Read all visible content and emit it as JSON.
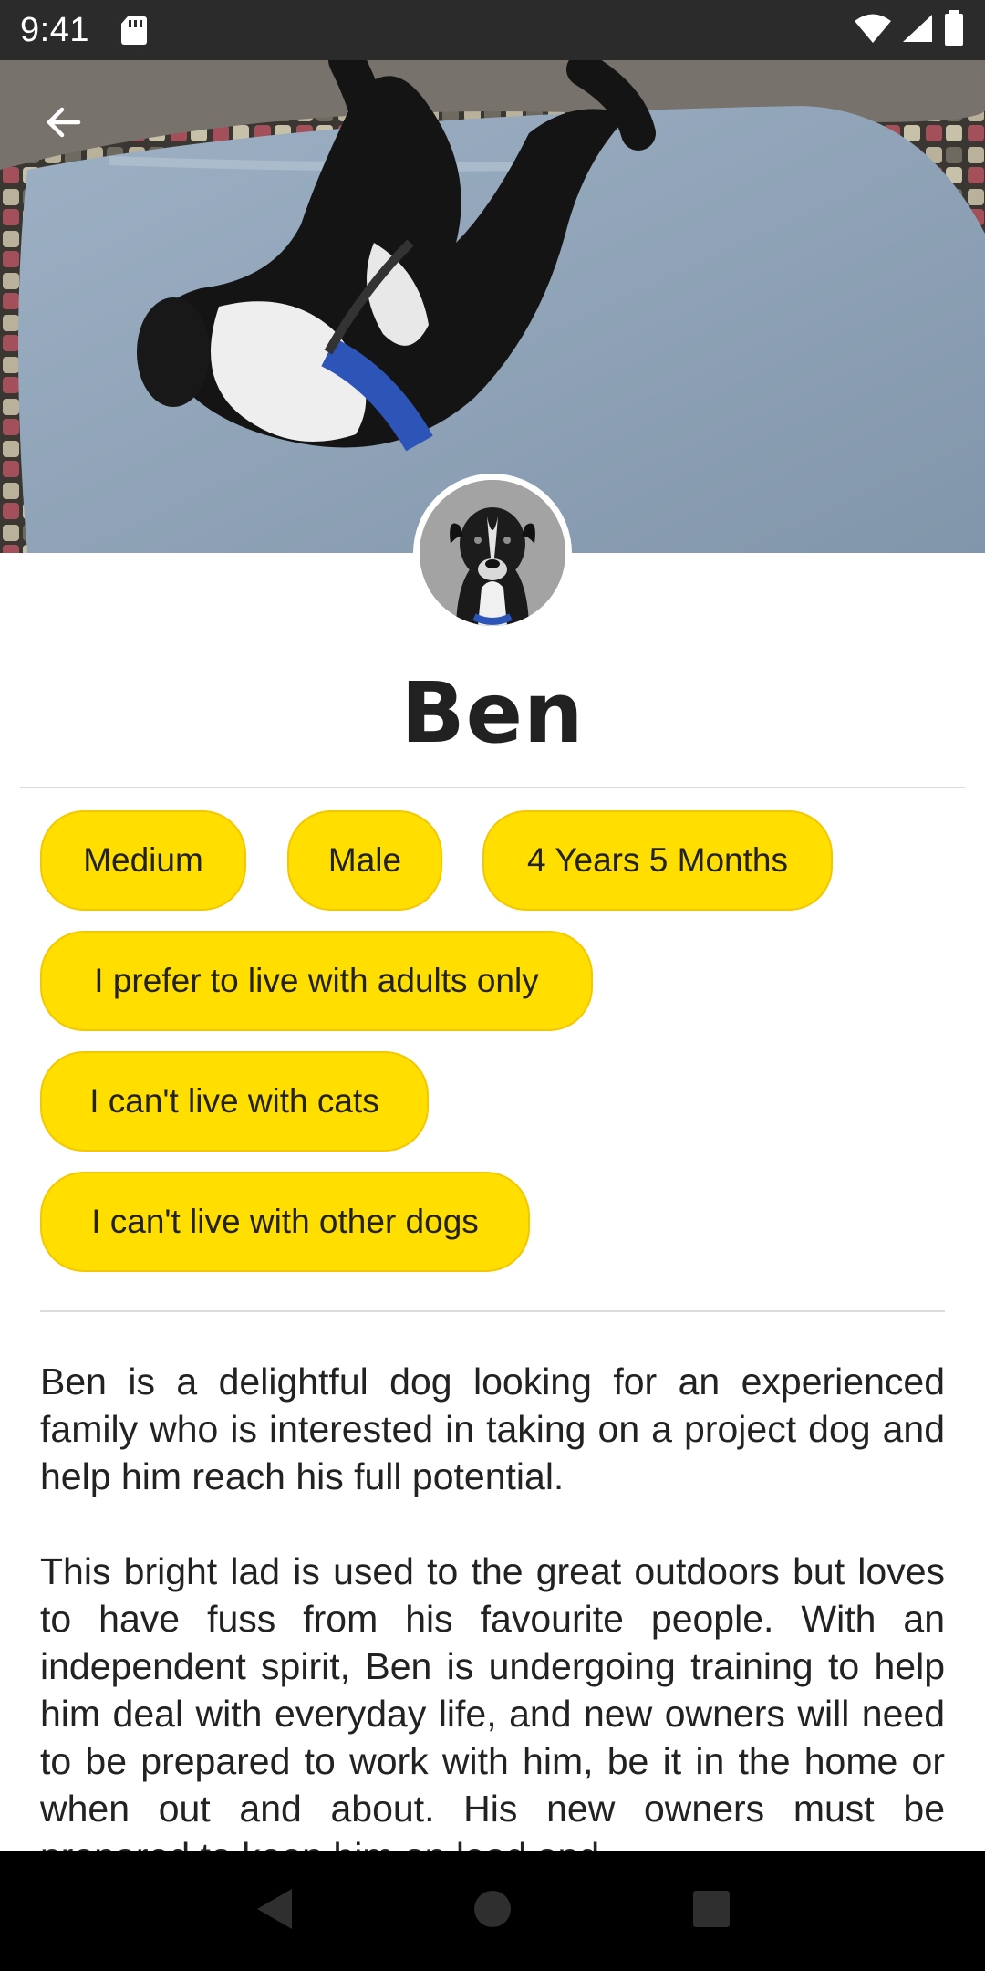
{
  "status_bar": {
    "time": "9:41",
    "icons": [
      "sd-card-icon",
      "wifi-icon",
      "signal-icon",
      "battery-icon"
    ]
  },
  "hero": {
    "back_icon": "arrow-left-icon",
    "photo": "dog lying on back on blue blanket"
  },
  "profile": {
    "name": "Ben"
  },
  "chips": [
    {
      "label": "Medium"
    },
    {
      "label": "Male"
    },
    {
      "label": "4 Years 5 Months"
    },
    {
      "label": "I prefer to live with adults only"
    },
    {
      "label": "I can't live with cats"
    },
    {
      "label": "I can't live with other dogs"
    }
  ],
  "description": {
    "paragraph_1": "Ben is a delightful dog looking for an experienced family who is interested in taking on a project dog and help him reach his full potential.",
    "paragraph_2": "This bright lad is used to the great outdoors but loves to have fuss from his favourite people. With an independent spirit, Ben is undergoing training to help him deal with everyday life, and new owners will need to be prepared to work with him, be it in the home or when out and about. His new owners must be prepared to keep him on lead and"
  },
  "nav_bar": {
    "icons": [
      "back-triangle-icon",
      "home-circle-icon",
      "recents-square-icon"
    ]
  },
  "colors": {
    "chip_fill": "#ffde00",
    "chip_border": "#f3c800",
    "status_bar": "#2b2b2b",
    "nav_bar": "#000000"
  }
}
